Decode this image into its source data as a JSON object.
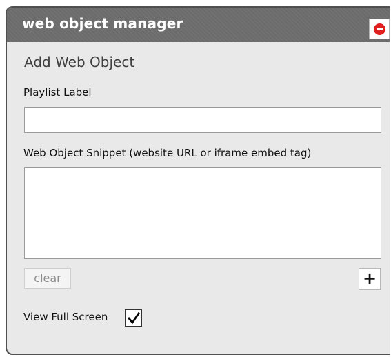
{
  "window": {
    "title": "web object manager"
  },
  "form": {
    "heading": "Add Web Object",
    "playlist_label": {
      "label": "Playlist Label",
      "value": ""
    },
    "snippet": {
      "label": "Web Object Snippet (website URL or iframe embed tag)",
      "value": ""
    },
    "clear_label": "clear",
    "add_label": "+",
    "full_screen": {
      "label": "View Full Screen",
      "checked": true
    }
  },
  "colors": {
    "titlebar": "#6c6c6c",
    "panel": "#e9e9e9",
    "close_icon": "#e01f1f"
  },
  "icons": {
    "close": "close-icon",
    "check": "checkmark-icon"
  }
}
